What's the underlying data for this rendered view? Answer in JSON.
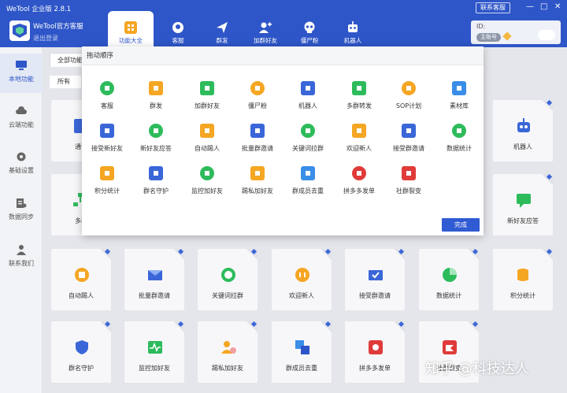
{
  "window": {
    "title": "WeTool 企业版 2.8.1",
    "support_label": "联系客服",
    "minimize": "—",
    "maximize": "□",
    "close": "✕"
  },
  "account": {
    "name": "WeTool官方客服",
    "logout": "退出登录"
  },
  "nav_tabs": [
    {
      "label": "功能大全",
      "icon": "grid-icon",
      "active": true
    },
    {
      "label": "客服",
      "icon": "headset-icon"
    },
    {
      "label": "群发",
      "icon": "send-icon"
    },
    {
      "label": "加群好友",
      "icon": "add-user-icon"
    },
    {
      "label": "僵尸粉",
      "icon": "skull-icon"
    },
    {
      "label": "机器人",
      "icon": "robot-icon"
    }
  ],
  "id_panel": {
    "label": "ID:",
    "badge": "主账号"
  },
  "sidebar": {
    "items": [
      {
        "label": "本地功能",
        "icon": "monitor-icon",
        "active": true
      },
      {
        "label": "云端功能",
        "icon": "cloud-icon"
      },
      {
        "label": "基础设置",
        "icon": "gear-icon"
      },
      {
        "label": "数据同步",
        "icon": "sync-icon"
      },
      {
        "label": "联系我们",
        "icon": "person-icon"
      }
    ]
  },
  "filter": {
    "all_features": "全部功能",
    "all": "所有"
  },
  "dialog": {
    "title": "拖动顺序",
    "done": "完成",
    "items": [
      {
        "label": "客服",
        "color": "#2ebb5c"
      },
      {
        "label": "群发",
        "color": "#f5a623"
      },
      {
        "label": "加群好友",
        "color": "#2ebb5c"
      },
      {
        "label": "僵尸粉",
        "color": "#f5a623"
      },
      {
        "label": "机器人",
        "color": "#3a66d8"
      },
      {
        "label": "多群转发",
        "color": "#2ebb5c"
      },
      {
        "label": "SOP计划",
        "color": "#f5a623"
      },
      {
        "label": "素材库",
        "color": "#3a8ee8"
      },
      {
        "label": "接受新好友",
        "color": "#3a66d8"
      },
      {
        "label": "新好友应答",
        "color": "#2ebb5c"
      },
      {
        "label": "自动踢人",
        "color": "#f5a623"
      },
      {
        "label": "批量群邀请",
        "color": "#3a66d8"
      },
      {
        "label": "关键词拉群",
        "color": "#2ebb5c"
      },
      {
        "label": "欢迎新人",
        "color": "#f5a623"
      },
      {
        "label": "接受群邀请",
        "color": "#3a66d8"
      },
      {
        "label": "数据统计",
        "color": "#2ebb5c"
      },
      {
        "label": "积分统计",
        "color": "#f5a623"
      },
      {
        "label": "群名守护",
        "color": "#3a66d8"
      },
      {
        "label": "监控加好友",
        "color": "#2ebb5c"
      },
      {
        "label": "踢私加好友",
        "color": "#f5a623"
      },
      {
        "label": "群成员去重",
        "color": "#3a8ee8"
      },
      {
        "label": "拼多多发单",
        "color": "#e03a3a"
      },
      {
        "label": "社群裂变",
        "color": "#e03a3a"
      }
    ]
  },
  "cards": {
    "row1_left": "通讯",
    "row2_left": "多群",
    "robot": "机器人",
    "new_friend_reply": "新好友应答",
    "row3": [
      {
        "label": "自动踢人",
        "color": "#f5a623"
      },
      {
        "label": "批量群邀请",
        "color": "#3a66d8"
      },
      {
        "label": "关键词拉群",
        "color": "#2ebb5c"
      },
      {
        "label": "欢迎新人",
        "color": "#f5a623"
      },
      {
        "label": "接受群邀请",
        "color": "#3a66d8"
      },
      {
        "label": "数据统计",
        "color": "#2ebb5c"
      },
      {
        "label": "积分统计",
        "color": "#f5a623"
      }
    ],
    "row4": [
      {
        "label": "群名守护",
        "color": "#3a66d8"
      },
      {
        "label": "监控加好友",
        "color": "#2ebb5c"
      },
      {
        "label": "踢私加好友",
        "color": "#f5a623"
      },
      {
        "label": "群成员去重",
        "color": "#3a8ee8"
      },
      {
        "label": "拼多多发单",
        "color": "#e03a3a"
      },
      {
        "label": "社群裂变",
        "color": "#e03a3a"
      }
    ]
  },
  "watermark": "知乎 @科技达人"
}
